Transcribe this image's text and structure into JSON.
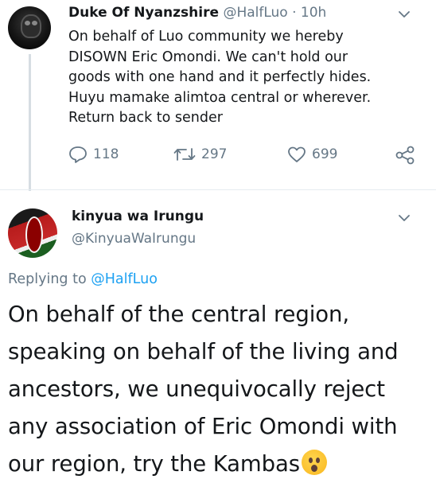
{
  "tweet1": {
    "display_name": "Duke Of Nyanzshire",
    "handle": "@HalfLuo",
    "separator": "·",
    "time": "10h",
    "lines": [
      "On behalf of Luo community we hereby",
      "DISOWN Eric Omondi. We can't hold our",
      "goods with one hand and it perfectly hides.",
      "Huyu mamake alimtoa central or wherever.",
      "Return back to sender"
    ],
    "replies": "118",
    "retweets": "297",
    "likes": "699"
  },
  "tweet2": {
    "display_name": "kinyua wa Irungu",
    "handle": "@KinyuaWaIrungu",
    "replying_label": "Replying to",
    "replying_handle": "@HalfLuo",
    "lines": [
      "On behalf of the central region,",
      "speaking on behalf of the living and",
      "ancestors, we unequivocally reject",
      "any association of Eric Omondi with",
      "our region, try the Kambas"
    ]
  },
  "colors": {
    "text": "#14171a",
    "muted": "#657786",
    "link": "#1da1f2",
    "divider": "#e6ecf0"
  }
}
